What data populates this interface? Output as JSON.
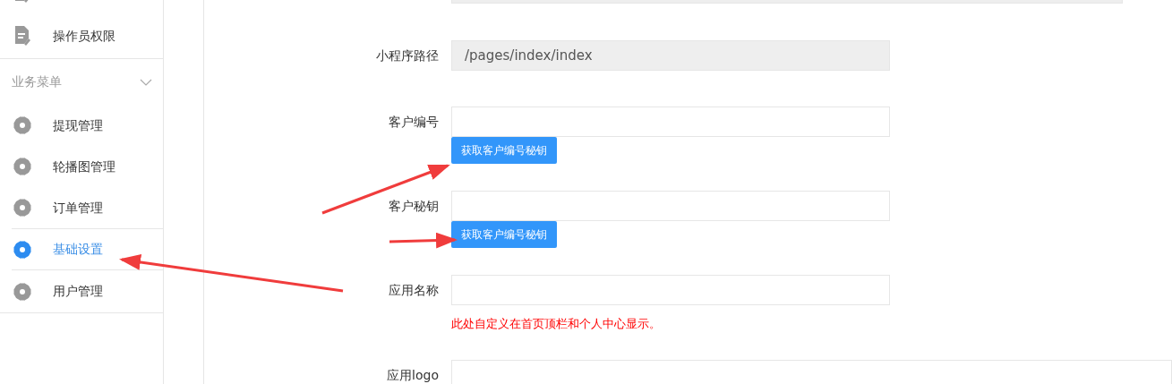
{
  "sidebar": {
    "top_items": [
      {
        "kind": "doc",
        "selected": false
      },
      {
        "kind": "doc",
        "label": "操作员权限",
        "selected": false
      }
    ],
    "group": {
      "label": "业务菜单",
      "expanded": true,
      "items": [
        {
          "kind": "gear",
          "label": "提现管理",
          "selected": false
        },
        {
          "kind": "gear",
          "label": "轮播图管理",
          "selected": false
        },
        {
          "kind": "gear",
          "label": "订单管理",
          "selected": false
        }
      ]
    },
    "items": [
      {
        "kind": "gear",
        "label": "基础设置",
        "selected": true
      },
      {
        "kind": "gear",
        "label": "用户管理",
        "selected": false
      }
    ]
  },
  "form": {
    "fields": [
      {
        "kind": "readonly-wide"
      },
      {
        "kind": "readonly",
        "label": "小程序路径",
        "value": "/pages/index/index"
      },
      {
        "kind": "input",
        "label": "客户编号",
        "button": "获取客户编号秘钥"
      },
      {
        "kind": "input",
        "label": "客户秘钥",
        "button": "获取客户编号秘钥"
      },
      {
        "kind": "input",
        "label": "应用名称",
        "hint": "此处自定义在首页顶栏和个人中心显示。"
      },
      {
        "kind": "wide",
        "label": "应用logo"
      }
    ]
  }
}
